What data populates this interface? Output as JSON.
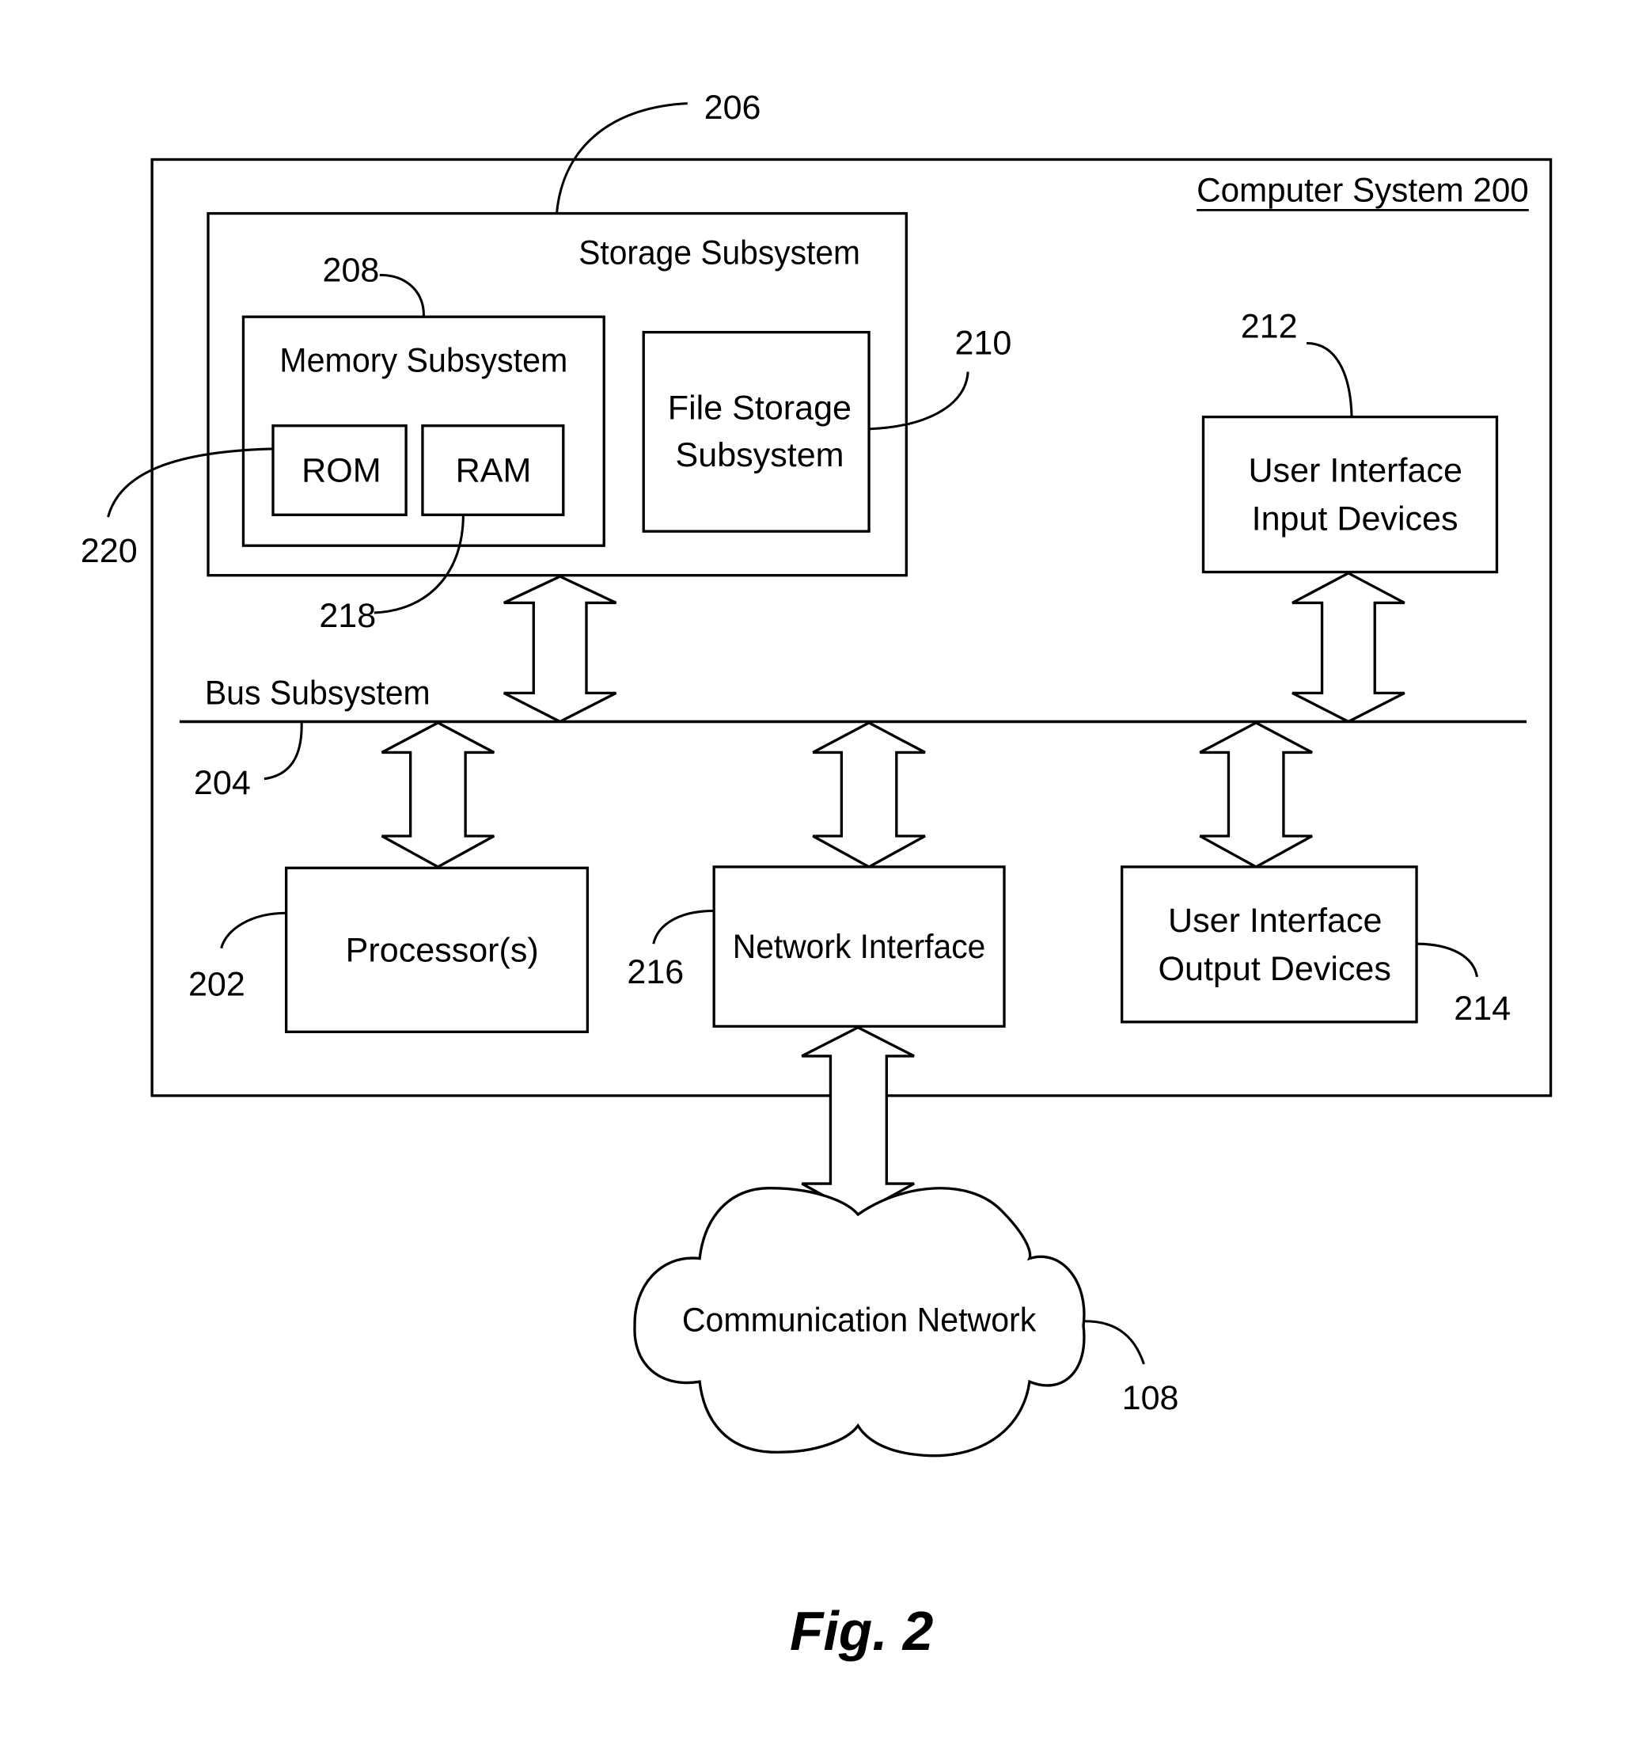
{
  "figure": {
    "caption": "Fig. 2",
    "computer_system": {
      "label": "Computer System  200"
    },
    "storage_subsystem": {
      "label": "Storage Subsystem",
      "ref": "206"
    },
    "memory_subsystem": {
      "label": "Memory Subsystem",
      "ref": "208"
    },
    "rom": {
      "label": "ROM",
      "ref": "220"
    },
    "ram": {
      "label": "RAM",
      "ref": "218"
    },
    "file_storage": {
      "line1": "File Storage",
      "line2": "Subsystem",
      "ref": "210"
    },
    "ui_input": {
      "line1": "User Interface",
      "line2": "Input Devices",
      "ref": "212"
    },
    "bus": {
      "label": "Bus Subsystem",
      "ref": "204"
    },
    "processor": {
      "label": "Processor(s)",
      "ref": "202"
    },
    "network_interface": {
      "label": "Network Interface",
      "ref": "216"
    },
    "ui_output": {
      "line1": "User Interface",
      "line2": "Output Devices",
      "ref": "214"
    },
    "network": {
      "label": "Communication Network",
      "ref": "108"
    }
  }
}
